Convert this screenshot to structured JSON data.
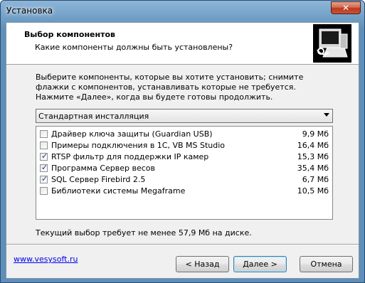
{
  "window": {
    "title": "Установка",
    "close_label": "✕"
  },
  "header": {
    "title": "Выбор компонентов",
    "subtitle": "Какие компоненты должны быть установлены?",
    "logo_icon": "installer-computer-icon"
  },
  "description": "Выберите компоненты, которые вы хотите установить; снимите флажки с компонентов, устанавливать которые не требуется. Нажмите «Далее», когда вы будете готовы продолжить.",
  "install_type": {
    "selected": "Стандартная инсталляция"
  },
  "components": [
    {
      "label": "Драйвер ключа защиты (Guardian USB)",
      "size": "9,9 Мб",
      "checked": false
    },
    {
      "label": "Примеры подключения в 1С, VB MS Studio",
      "size": "16,4 Мб",
      "checked": false
    },
    {
      "label": "RTSP фильтр для поддержки IP камер",
      "size": "15,3 Мб",
      "checked": true
    },
    {
      "label": "Программа Сервер весов",
      "size": "35,4 Мб",
      "checked": true
    },
    {
      "label": "SQL Сервер Firebird 2.5",
      "size": "6,7 Мб",
      "checked": true
    },
    {
      "label": "Библиотеки системы Megaframe",
      "size": "10,5 Мб",
      "checked": false
    }
  ],
  "requirement_text": "Текущий выбор требует не менее 57,9 Мб на диске.",
  "footer": {
    "link": "www.vesysoft.ru",
    "back_label": "< Назад",
    "next_label": "Далее >",
    "cancel_label": "Отмена"
  },
  "colors": {
    "link": "#0000ee",
    "checkmark": "#1b3b8a",
    "title_bar": "#5f8fb9",
    "close_button": "#c7533a"
  }
}
